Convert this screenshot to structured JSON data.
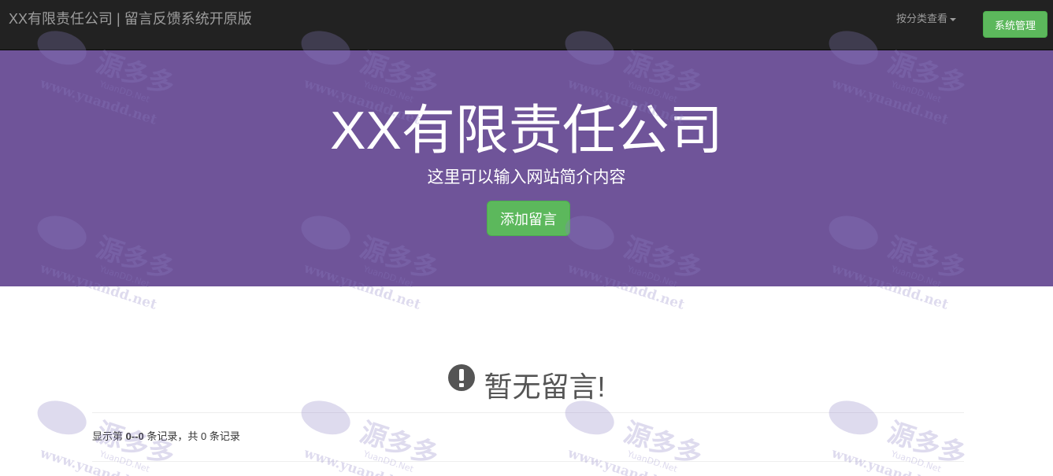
{
  "navbar": {
    "brand": "XX有限责任公司 | 留言反馈系统开原版",
    "category_dropdown": "按分类查看",
    "admin_button": "系统管理"
  },
  "hero": {
    "title": "XX有限责任公司",
    "subtitle": "这里可以输入网站简介内容",
    "add_button": "添加留言"
  },
  "content": {
    "empty_message": "暂无留言!",
    "pager": {
      "prefix": "显示第 ",
      "range": "0--0",
      "middle": " 条记录，共 ",
      "total": "0",
      "suffix": " 条记录"
    }
  },
  "watermark": {
    "text": "源多多",
    "sub": "YuanDD.Net",
    "url": "www.yuandd.net"
  },
  "colors": {
    "navbar_bg": "#222222",
    "hero_bg": "#6f5499",
    "success": "#5cb85c",
    "watermark": "#8c7fc4"
  }
}
